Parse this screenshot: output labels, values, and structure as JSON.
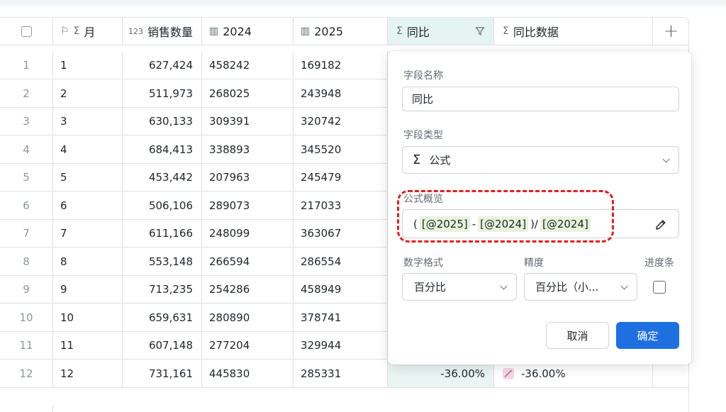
{
  "header": {
    "col_month": "月",
    "col_sales": "销售数量",
    "col_2024": "2024",
    "col_2025": "2025",
    "col_yoy": "同比",
    "col_yoy_data": "同比数据",
    "add_col": "+"
  },
  "rows": [
    {
      "index": "1",
      "month": "1",
      "sales": "627,424",
      "y2024": "458242",
      "y2025": "169182"
    },
    {
      "index": "2",
      "month": "2",
      "sales": "511,973",
      "y2024": "268025",
      "y2025": "243948"
    },
    {
      "index": "3",
      "month": "3",
      "sales": "630,133",
      "y2024": "309391",
      "y2025": "320742"
    },
    {
      "index": "4",
      "month": "4",
      "sales": "684,413",
      "y2024": "338893",
      "y2025": "345520"
    },
    {
      "index": "5",
      "month": "5",
      "sales": "453,442",
      "y2024": "207963",
      "y2025": "245479"
    },
    {
      "index": "6",
      "month": "6",
      "sales": "506,106",
      "y2024": "289073",
      "y2025": "217033"
    },
    {
      "index": "7",
      "month": "7",
      "sales": "611,166",
      "y2024": "248099",
      "y2025": "363067"
    },
    {
      "index": "8",
      "month": "8",
      "sales": "553,148",
      "y2024": "266594",
      "y2025": "286554"
    },
    {
      "index": "9",
      "month": "9",
      "sales": "713,235",
      "y2024": "254286",
      "y2025": "458949"
    },
    {
      "index": "10",
      "month": "10",
      "sales": "659,631",
      "y2024": "280890",
      "y2025": "378741"
    },
    {
      "index": "11",
      "month": "11",
      "sales": "607,148",
      "y2024": "277204",
      "y2025": "329944"
    },
    {
      "index": "12",
      "month": "12",
      "sales": "731,161",
      "y2024": "445830",
      "y2025": "285331",
      "yoy": "-36.00%",
      "yoy_data": "-36.00%"
    }
  ],
  "add_row": "+",
  "panel": {
    "field_name_label": "字段名称",
    "field_name_value": "同比",
    "field_type_label": "字段类型",
    "field_type_value": "公式",
    "formula_label": "公式概览",
    "formula": {
      "open": "(",
      "t1": "[@2025]",
      "minus": "-",
      "t2": "[@2024]",
      "close_div": ")/",
      "t3": "[@2024]"
    },
    "num_format_label": "数字格式",
    "num_format_value": "百分比",
    "precision_label": "精度",
    "precision_value": "百分比（小...",
    "progress_label": "进度条",
    "cancel": "取消",
    "confirm": "确定"
  },
  "colors": {
    "accent": "#1e6fe0",
    "highlight_column": "#e6f4f1",
    "annotation": "#e02020",
    "token_bg": "#e8f3dc"
  }
}
